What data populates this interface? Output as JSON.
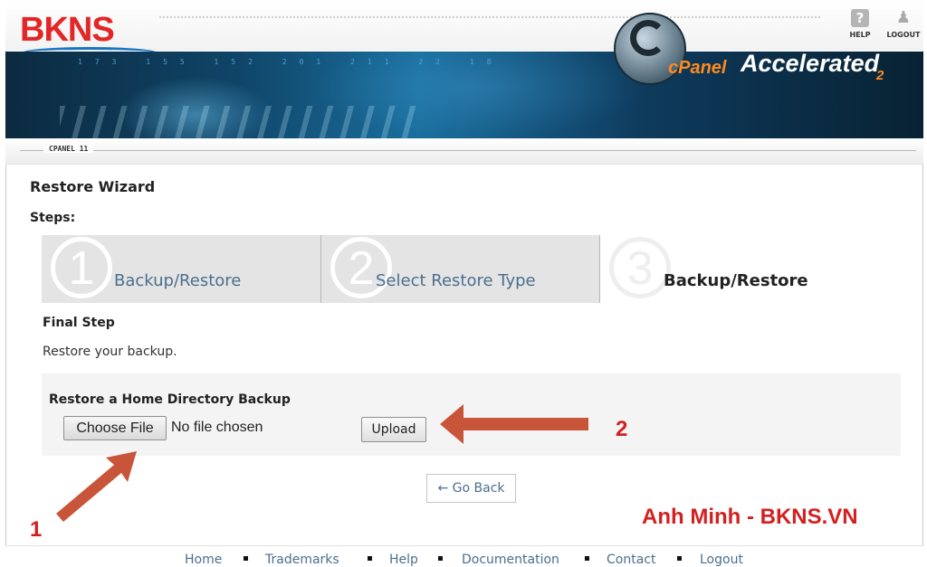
{
  "brand": {
    "logo_text": "BKNS",
    "colors": {
      "logo": "#e32626",
      "swoosh": "#1776c5",
      "annotation": "#d02020",
      "link": "#4a6f8e"
    }
  },
  "header": {
    "help": {
      "label": "HELP",
      "icon": "question-icon"
    },
    "logout": {
      "label": "LOGOUT",
      "icon": "user-icon"
    }
  },
  "banner": {
    "logo_text": "cPanel",
    "product_text": "Accelerated",
    "product_suffix": "2"
  },
  "version": "CPANEL 11",
  "page": {
    "title": "Restore Wizard",
    "steps_label": "Steps:",
    "steps": [
      {
        "number": "1",
        "label": "Backup/Restore",
        "active": false
      },
      {
        "number": "2",
        "label": "Select Restore Type",
        "active": false
      },
      {
        "number": "3",
        "label": "Backup/Restore",
        "active": true
      }
    ],
    "final_step": "Final Step",
    "description": "Restore your backup."
  },
  "restore_panel": {
    "title": "Restore a Home Directory Backup",
    "choose_file": "Choose File",
    "file_status": "No file chosen",
    "upload": "Upload"
  },
  "go_back": "← Go Back",
  "annotations": {
    "one": "1",
    "two": "2",
    "credit": "Anh Minh - BKNS.VN"
  },
  "footer": {
    "links": [
      "Home",
      "Trademarks",
      "Help",
      "Documentation",
      "Contact",
      "Logout"
    ]
  }
}
